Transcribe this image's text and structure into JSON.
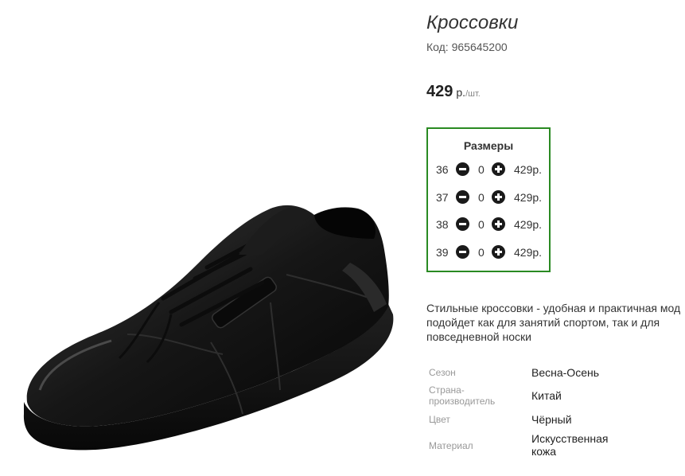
{
  "product": {
    "title": "Кроссовки",
    "code_line": "Код: 965645200",
    "image_alt": "shoe",
    "price": {
      "value": "429",
      "currency": "р.",
      "unit": "/шт."
    }
  },
  "sizes": {
    "title": "Размеры",
    "rows": [
      {
        "size": "36",
        "qty": "0",
        "price": "429р."
      },
      {
        "size": "37",
        "qty": "0",
        "price": "429р."
      },
      {
        "size": "38",
        "qty": "0",
        "price": "429р."
      },
      {
        "size": "39",
        "qty": "0",
        "price": "429р."
      }
    ]
  },
  "description": {
    "line1": "Стильные кроссовки - удобная и практичная мод",
    "line2": "подойдет как для занятий спортом, так и для",
    "line3": "повседневной носки"
  },
  "properties": [
    {
      "label": "Сезон",
      "value": "Весна-Осень"
    },
    {
      "label": "Страна-производитель",
      "label_line1": "Страна-",
      "label_line2": "производитель",
      "value": "Китай"
    },
    {
      "label": "Цвет",
      "value": "Чёрный"
    },
    {
      "label": "Материал",
      "value": "Искусственная кожа",
      "value_line1": "Искусственная",
      "value_line2": "кожа"
    }
  ],
  "colors": {
    "sizes_border": "#2a8a22",
    "shoe": "#141414"
  }
}
